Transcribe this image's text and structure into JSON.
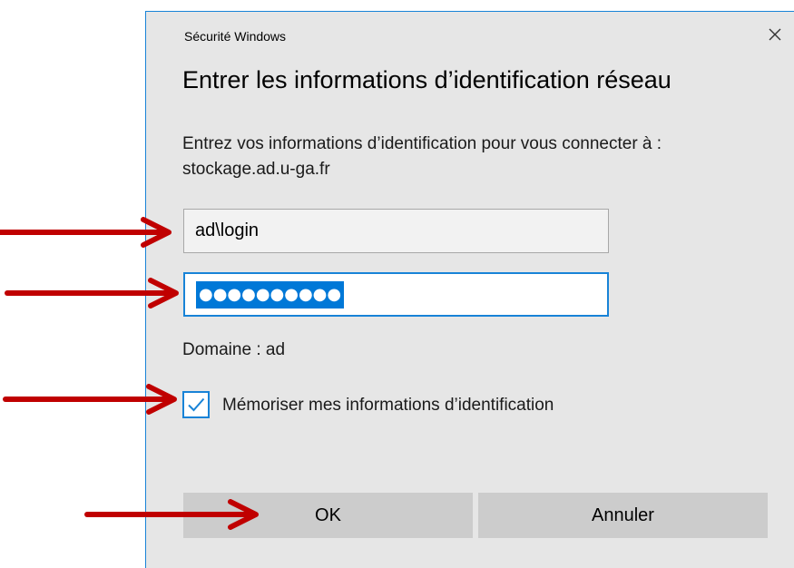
{
  "dialog": {
    "window_title": "Sécurité Windows",
    "heading": "Entrer les informations d’identification réseau",
    "description": "Entrez vos informations d’identification pour vous connecter à : stockage.ad.u-ga.fr",
    "username": {
      "value": "ad\\login"
    },
    "password": {
      "masked_value": "●●●●●●●●●●",
      "selected": true
    },
    "domain_text": "Domaine : ad",
    "remember": {
      "label": "Mémoriser mes informations d’identification",
      "checked": true
    },
    "buttons": {
      "ok_label": "OK",
      "cancel_label": "Annuler"
    }
  },
  "icons": {
    "close": "close-icon",
    "check": "checkmark-icon",
    "arrow": "arrow-right-icon"
  },
  "colors": {
    "dialog_background": "#e6e6e6",
    "accent": "#0078d7",
    "border_accent": "#1883d7",
    "button_background": "#cccccc",
    "annotation_arrow": "#c00000"
  }
}
